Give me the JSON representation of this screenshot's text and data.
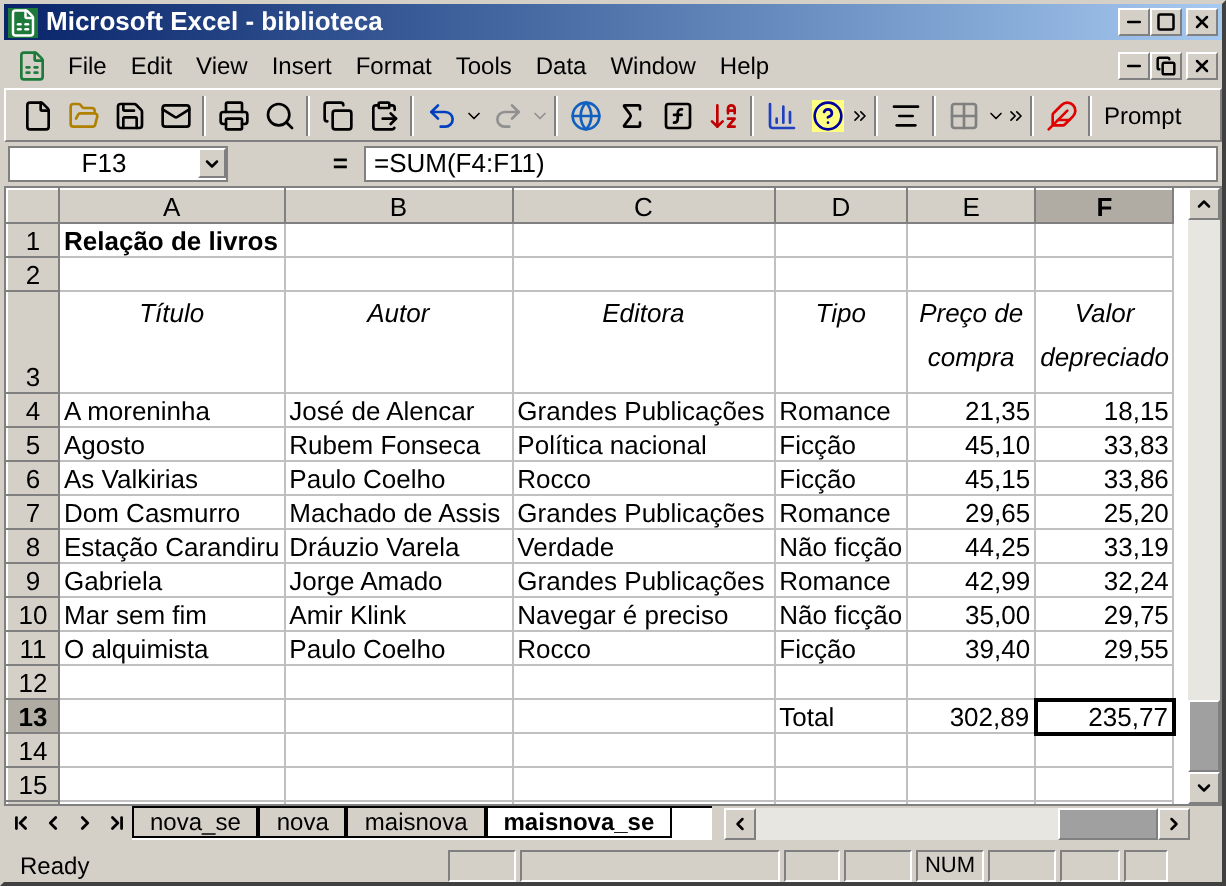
{
  "window": {
    "title": "Microsoft Excel - biblioteca"
  },
  "menu": [
    "File",
    "Edit",
    "View",
    "Insert",
    "Format",
    "Tools",
    "Data",
    "Window",
    "Help"
  ],
  "toolbar": {
    "prompt_label": "Prompt"
  },
  "formula_bar": {
    "name_box": "F13",
    "equals": "=",
    "formula": "=SUM(F4:F11)"
  },
  "columns": [
    {
      "label": "A",
      "selected": false,
      "kind": "text"
    },
    {
      "label": "B",
      "selected": false,
      "kind": "text"
    },
    {
      "label": "C",
      "selected": false,
      "kind": "text"
    },
    {
      "label": "D",
      "selected": false,
      "kind": "text"
    },
    {
      "label": "E",
      "selected": false,
      "kind": "number"
    },
    {
      "label": "F",
      "selected": true,
      "kind": "number"
    }
  ],
  "rows": [
    {
      "number": "1",
      "selected": false,
      "kind": "title",
      "cells": {
        "A": "Relação de livros"
      }
    },
    {
      "number": "2",
      "selected": false,
      "kind": "data",
      "cells": {}
    },
    {
      "number": "3",
      "selected": false,
      "kind": "header",
      "cells": {
        "A": "Título",
        "B": "Autor",
        "C": "Editora",
        "D": "Tipo",
        "E": "Preço de compra",
        "F": "Valor depreciado"
      }
    },
    {
      "number": "4",
      "selected": false,
      "kind": "data",
      "cells": {
        "A": "A moreninha",
        "B": "José de Alencar",
        "C": "Grandes Publicações",
        "D": "Romance",
        "E": "21,35",
        "F": "18,15"
      }
    },
    {
      "number": "5",
      "selected": false,
      "kind": "data",
      "cells": {
        "A": "Agosto",
        "B": "Rubem Fonseca",
        "C": "Política nacional",
        "D": "Ficção",
        "E": "45,10",
        "F": "33,83"
      }
    },
    {
      "number": "6",
      "selected": false,
      "kind": "data",
      "cells": {
        "A": "As Valkirias",
        "B": "Paulo Coelho",
        "C": "Rocco",
        "D": "Ficção",
        "E": "45,15",
        "F": "33,86"
      }
    },
    {
      "number": "7",
      "selected": false,
      "kind": "data",
      "cells": {
        "A": "Dom Casmurro",
        "B": "Machado de Assis",
        "C": "Grandes Publicações",
        "D": "Romance",
        "E": "29,65",
        "F": "25,20"
      }
    },
    {
      "number": "8",
      "selected": false,
      "kind": "data",
      "cells": {
        "A": "Estação Carandiru",
        "B": "Dráuzio Varela",
        "C": "Verdade",
        "D": "Não ficção",
        "E": "44,25",
        "F": "33,19"
      }
    },
    {
      "number": "9",
      "selected": false,
      "kind": "data",
      "cells": {
        "A": "Gabriela",
        "B": "Jorge Amado",
        "C": "Grandes Publicações",
        "D": "Romance",
        "E": "42,99",
        "F": "32,24"
      }
    },
    {
      "number": "10",
      "selected": false,
      "kind": "data",
      "cells": {
        "A": "Mar sem fim",
        "B": "Amir Klink",
        "C": "Navegar é preciso",
        "D": "Não ficção",
        "E": "35,00",
        "F": "29,75"
      }
    },
    {
      "number": "11",
      "selected": false,
      "kind": "data",
      "cells": {
        "A": "O alquimista",
        "B": "Paulo Coelho",
        "C": "Rocco",
        "D": "Ficção",
        "E": "39,40",
        "F": "29,55"
      }
    },
    {
      "number": "12",
      "selected": false,
      "kind": "data",
      "cells": {}
    },
    {
      "number": "13",
      "selected": true,
      "kind": "data",
      "cells": {
        "D": "Total",
        "E": "302,89",
        "F": "235,77"
      }
    },
    {
      "number": "14",
      "selected": false,
      "kind": "data",
      "cells": {}
    },
    {
      "number": "15",
      "selected": false,
      "kind": "data",
      "cells": {}
    }
  ],
  "sheet_tabs": [
    {
      "label": "nova_se",
      "selected": false
    },
    {
      "label": "nova",
      "selected": false
    },
    {
      "label": "maisnova",
      "selected": false
    },
    {
      "label": "maisnova_se",
      "selected": true
    }
  ],
  "status_bar": {
    "text": "Ready",
    "indicators": [
      "NUM"
    ]
  }
}
